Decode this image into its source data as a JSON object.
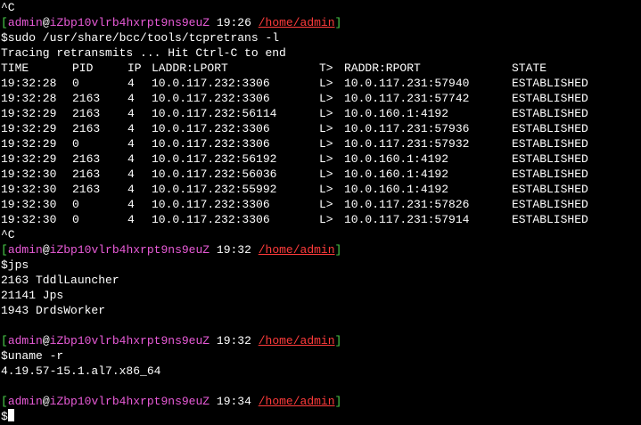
{
  "terminal": {
    "colors": {
      "background": "#000000",
      "text": "#ffffff",
      "prompt_bracket": "#4dd34d",
      "user": "#e95bd8",
      "host": "#e95bd8",
      "path": "#ff3b3b"
    },
    "interrupt": "^C",
    "prompt": {
      "open": "[",
      "user": "admin",
      "at": "@",
      "host": "iZbp10vlrb4hxrpt9ns9euZ",
      "path": "/home/admin",
      "close": "]"
    },
    "session1": {
      "time": "19:26",
      "command": "$sudo /usr/share/bcc/tools/tcpretrans -l",
      "banner": "Tracing retransmits ... Hit Ctrl-C to end",
      "headers": {
        "time": "TIME",
        "pid": "PID",
        "ip": "IP",
        "laddr": "LADDR:LPORT",
        "t": "T>",
        "raddr": "RADDR:RPORT",
        "state": "STATE"
      },
      "rows": [
        {
          "time": "19:32:28",
          "pid": "0",
          "ip": "4",
          "laddr": "10.0.117.232:3306",
          "t": "L>",
          "raddr": "10.0.117.231:57940",
          "state": "ESTABLISHED"
        },
        {
          "time": "19:32:28",
          "pid": "2163",
          "ip": "4",
          "laddr": "10.0.117.232:3306",
          "t": "L>",
          "raddr": "10.0.117.231:57742",
          "state": "ESTABLISHED"
        },
        {
          "time": "19:32:29",
          "pid": "2163",
          "ip": "4",
          "laddr": "10.0.117.232:56114",
          "t": "L>",
          "raddr": "10.0.160.1:4192",
          "state": "ESTABLISHED"
        },
        {
          "time": "19:32:29",
          "pid": "2163",
          "ip": "4",
          "laddr": "10.0.117.232:3306",
          "t": "L>",
          "raddr": "10.0.117.231:57936",
          "state": "ESTABLISHED"
        },
        {
          "time": "19:32:29",
          "pid": "0",
          "ip": "4",
          "laddr": "10.0.117.232:3306",
          "t": "L>",
          "raddr": "10.0.117.231:57932",
          "state": "ESTABLISHED"
        },
        {
          "time": "19:32:29",
          "pid": "2163",
          "ip": "4",
          "laddr": "10.0.117.232:56192",
          "t": "L>",
          "raddr": "10.0.160.1:4192",
          "state": "ESTABLISHED"
        },
        {
          "time": "19:32:30",
          "pid": "2163",
          "ip": "4",
          "laddr": "10.0.117.232:56036",
          "t": "L>",
          "raddr": "10.0.160.1:4192",
          "state": "ESTABLISHED"
        },
        {
          "time": "19:32:30",
          "pid": "2163",
          "ip": "4",
          "laddr": "10.0.117.232:55992",
          "t": "L>",
          "raddr": "10.0.160.1:4192",
          "state": "ESTABLISHED"
        },
        {
          "time": "19:32:30",
          "pid": "0",
          "ip": "4",
          "laddr": "10.0.117.232:3306",
          "t": "L>",
          "raddr": "10.0.117.231:57826",
          "state": "ESTABLISHED"
        },
        {
          "time": "19:32:30",
          "pid": "0",
          "ip": "4",
          "laddr": "10.0.117.232:3306",
          "t": "L>",
          "raddr": "10.0.117.231:57914",
          "state": "ESTABLISHED"
        }
      ]
    },
    "session2": {
      "time": "19:32",
      "command": "$jps",
      "output": [
        "2163 TddlLauncher",
        "21141 Jps",
        "1943 DrdsWorker"
      ]
    },
    "session3": {
      "time": "19:32",
      "command": "$uname -r",
      "output": [
        "4.19.57-15.1.al7.x86_64"
      ]
    },
    "session4": {
      "time": "19:34",
      "command": "$"
    }
  }
}
